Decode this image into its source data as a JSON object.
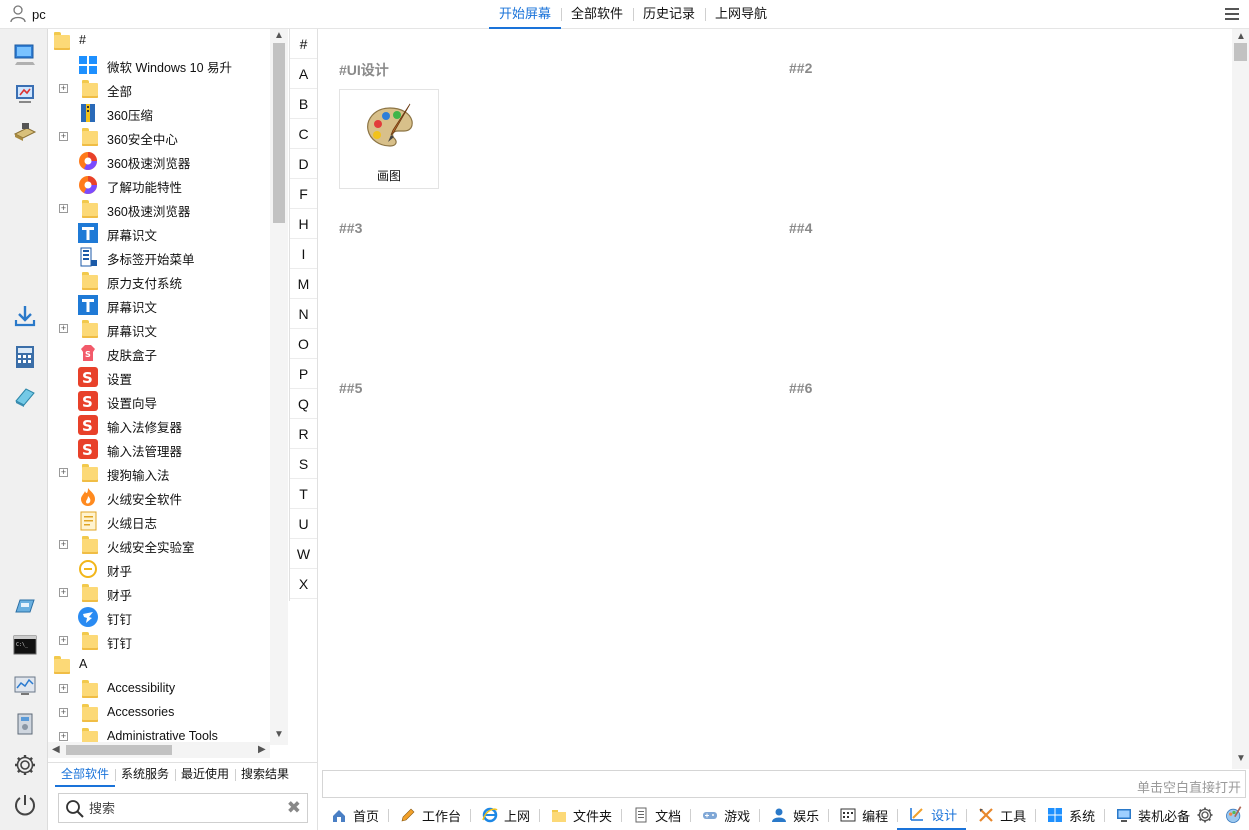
{
  "user": {
    "name": "pc"
  },
  "top_tabs": [
    {
      "label": "开始屏幕",
      "active": true
    },
    {
      "label": "全部软件",
      "active": false
    },
    {
      "label": "历史记录",
      "active": false
    },
    {
      "label": "上网导航",
      "active": false
    }
  ],
  "tree": {
    "rows": [
      {
        "label": "#",
        "kind": "folder-root",
        "expander": false
      },
      {
        "label": "微软 Windows 10 易升",
        "kind": "windows",
        "expander": false
      },
      {
        "label": "全部",
        "kind": "folder",
        "expander": true
      },
      {
        "label": "360压缩",
        "kind": "zip",
        "expander": false
      },
      {
        "label": "360安全中心",
        "kind": "folder",
        "expander": true
      },
      {
        "label": "360极速浏览器",
        "kind": "browser",
        "expander": false
      },
      {
        "label": "了解功能特性",
        "kind": "browser",
        "expander": false
      },
      {
        "label": "360极速浏览器",
        "kind": "folder",
        "expander": true
      },
      {
        "label": "屏幕识文",
        "kind": "textT",
        "expander": false
      },
      {
        "label": "多标签开始菜单",
        "kind": "menu",
        "expander": false
      },
      {
        "label": "原力支付系统",
        "kind": "folder",
        "expander": false
      },
      {
        "label": "屏幕识文",
        "kind": "textT",
        "expander": false
      },
      {
        "label": "屏幕识文",
        "kind": "folder",
        "expander": true
      },
      {
        "label": "皮肤盒子",
        "kind": "skin",
        "expander": false
      },
      {
        "label": "设置",
        "kind": "sogou",
        "expander": false
      },
      {
        "label": "设置向导",
        "kind": "sogou",
        "expander": false
      },
      {
        "label": "输入法修复器",
        "kind": "sogou",
        "expander": false
      },
      {
        "label": "输入法管理器",
        "kind": "sogou",
        "expander": false
      },
      {
        "label": "搜狗输入法",
        "kind": "folder",
        "expander": true
      },
      {
        "label": "火绒安全软件",
        "kind": "huorong",
        "expander": false
      },
      {
        "label": "火绒日志",
        "kind": "log",
        "expander": false
      },
      {
        "label": "火绒安全实验室",
        "kind": "folder",
        "expander": true
      },
      {
        "label": "财乎",
        "kind": "caihu",
        "expander": false
      },
      {
        "label": "财乎",
        "kind": "folder",
        "expander": true
      },
      {
        "label": "钉钉",
        "kind": "dingding",
        "expander": false
      },
      {
        "label": "钉钉",
        "kind": "folder",
        "expander": true
      },
      {
        "label": "A",
        "kind": "folder-root",
        "expander": false
      },
      {
        "label": "Accessibility",
        "kind": "folder",
        "expander": true
      },
      {
        "label": "Accessories",
        "kind": "folder",
        "expander": true
      },
      {
        "label": "Administrative Tools",
        "kind": "folder",
        "expander": true
      }
    ]
  },
  "tree_tabs": [
    {
      "label": "全部软件",
      "active": true
    },
    {
      "label": "系统服务",
      "active": false
    },
    {
      "label": "最近使用",
      "active": false
    },
    {
      "label": "搜索结果",
      "active": false
    }
  ],
  "search": {
    "placeholder": "搜索",
    "value": ""
  },
  "letters": [
    "#",
    "A",
    "B",
    "C",
    "D",
    "F",
    "H",
    "I",
    "M",
    "N",
    "O",
    "P",
    "Q",
    "R",
    "S",
    "T",
    "U",
    "W",
    "X"
  ],
  "groups": [
    {
      "title": "#UI设计"
    },
    {
      "title": "##2"
    },
    {
      "title": "##3"
    },
    {
      "title": "##4"
    },
    {
      "title": "##5"
    },
    {
      "title": "##6"
    }
  ],
  "tile": {
    "label": "画图",
    "icon": "paint-palette-icon"
  },
  "quick_open": {
    "text": "单击空白直接打开"
  },
  "categories": [
    {
      "label": "首页",
      "icon": "home-icon",
      "active": false
    },
    {
      "label": "工作台",
      "icon": "pencil-icon",
      "active": false
    },
    {
      "label": "上网",
      "icon": "ie-icon",
      "active": false
    },
    {
      "label": "文件夹",
      "icon": "folder-icon",
      "active": false
    },
    {
      "label": "文档",
      "icon": "document-icon",
      "active": false
    },
    {
      "label": "游戏",
      "icon": "gamepad-icon",
      "active": false
    },
    {
      "label": "娱乐",
      "icon": "user-icon",
      "active": false
    },
    {
      "label": "编程",
      "icon": "code-icon",
      "active": false
    },
    {
      "label": "设计",
      "icon": "design-icon",
      "active": true
    },
    {
      "label": "工具",
      "icon": "tools-icon",
      "active": false
    },
    {
      "label": "系统",
      "icon": "windows-icon",
      "active": false
    },
    {
      "label": "装机必备",
      "icon": "monitor-icon",
      "active": false
    }
  ],
  "colors": {
    "accent": "#1a73d9",
    "group_title": "#8a8a8a",
    "folder": "#fcd977"
  }
}
